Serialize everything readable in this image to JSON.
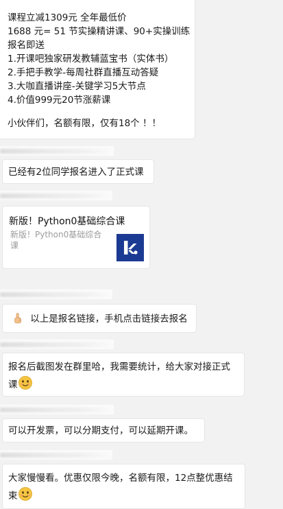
{
  "messages": {
    "promo": {
      "lines": [
        "课程立减1309元  全年最低价",
        "1688 元= 51 节实操精讲课、90+实操训练",
        "报名即送",
        "1.开课吧独家研发教辅蓝宝书（实体书）",
        "2.手把手教学-每周社群直播互动答疑",
        "3.大咖直播讲座-关键学习5大节点",
        "4.价值999元20节涨薪课"
      ],
      "closing": "小伙伴们，名额有限，仅有18个 ！！"
    },
    "enrolled": "已经有2位同学报名进入了正式课",
    "link_card": {
      "title": "新版！Python0基础综合课",
      "description": "新版！Python0基础综合课"
    },
    "signup_link": "以上是报名链接，手机点击链接去报名",
    "screenshot_line1": "报名后截图发在群里哈，我需要统计，给大家对接正式",
    "screenshot_line2": "课",
    "invoice": "可以开发票，可以分期支付，可以延期开课。",
    "deadline_line1": "大家慢慢看。优惠仅限今晚，名额有限，12点整优惠结",
    "deadline_line2": "束"
  },
  "icons": {
    "emoji_face": "smiling-face-emoji",
    "emoji_hand": "pointing-up-hand-emoji",
    "card_logo": "app-logo-icon"
  },
  "colors": {
    "background": "#f2f2f2",
    "bubble": "#ffffff",
    "logo": "#1b3a93",
    "emoji": "#f5c542"
  }
}
